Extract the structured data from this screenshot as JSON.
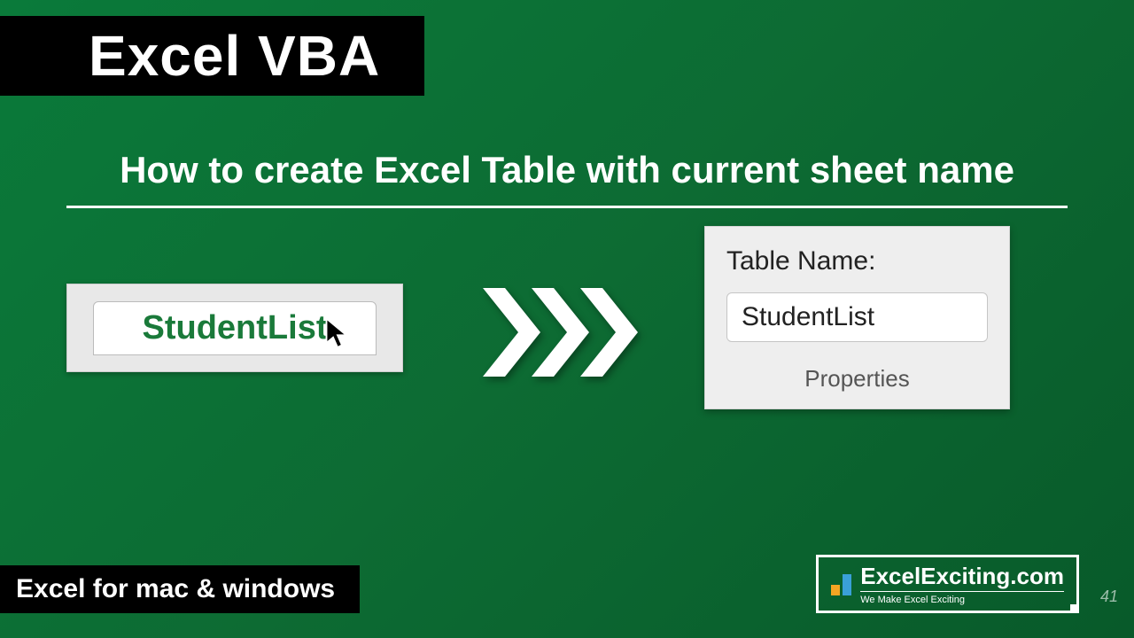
{
  "title": "Excel VBA",
  "subtitle": "How to create Excel Table with current sheet name",
  "sheet_tab": {
    "name": "StudentList"
  },
  "panel": {
    "label": "Table Name:",
    "value": "StudentList",
    "section": "Properties"
  },
  "platform": "Excel for mac & windows",
  "brand": {
    "name": "ExcelExciting.com",
    "tagline": "We Make Excel Exciting"
  },
  "page_number": "41"
}
